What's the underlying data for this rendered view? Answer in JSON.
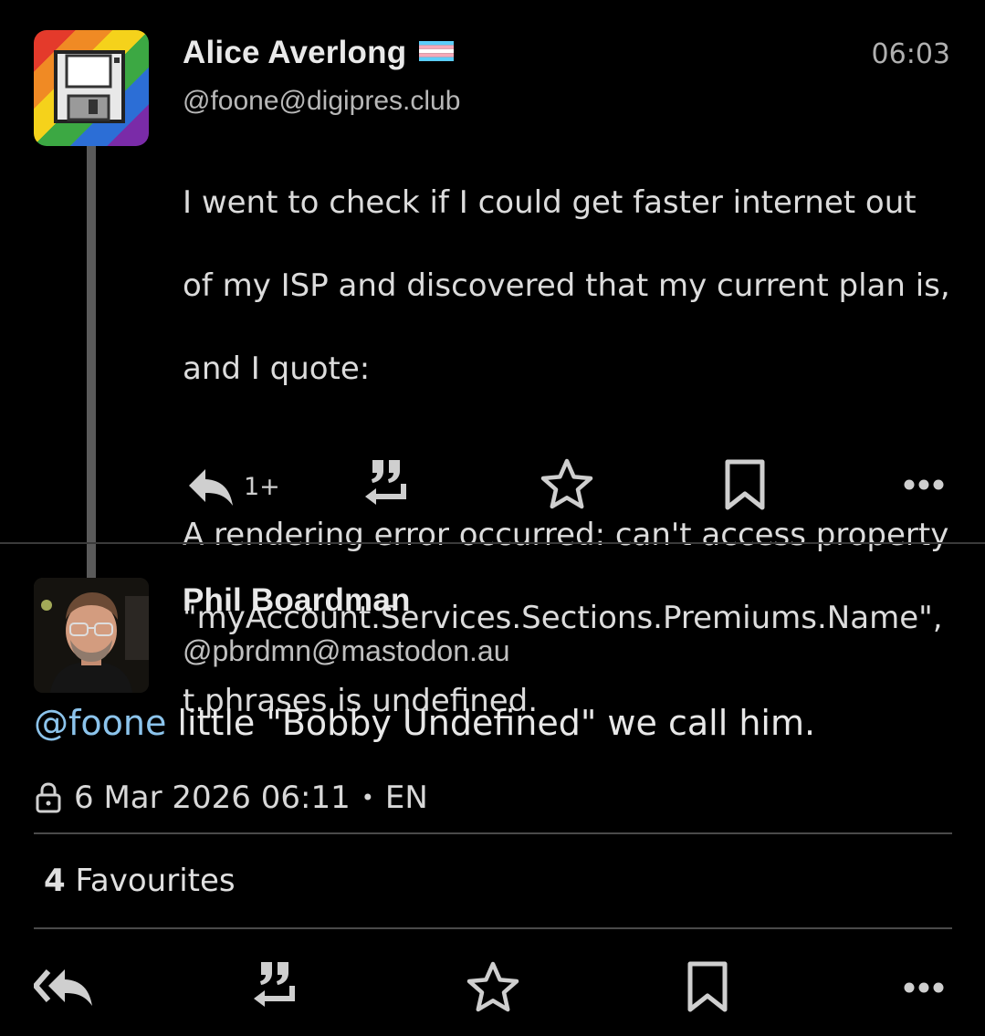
{
  "post": {
    "author_name": "Alice Averlong",
    "handle": "@foone@digipres.club",
    "time": "06:03",
    "body_lines": [
      "I went to check if I could get faster internet out",
      "of my ISP and discovered that my current plan is,",
      "and I quote:",
      "",
      "A rendering error occurred: can't access property",
      "\"myAccount.Services.Sections.Premiums.Name\",",
      "t.phrases is undefined."
    ],
    "reply_count": "1+",
    "icons": [
      "reply-icon",
      "boost-icon",
      "favourite-icon",
      "bookmark-icon",
      "more-icon"
    ]
  },
  "reply": {
    "author_name": "Phil Boardman",
    "handle": "@pbrdmn@mastodon.au",
    "mention": "@foone",
    "text": " little \"Bobby Undefined\" we call him.",
    "date": "6 Mar 2026 06:11",
    "separator": "•",
    "language": "EN",
    "favourites_count": "4",
    "favourites_label": "Favourites",
    "icons": [
      "reply-all-icon",
      "boost-icon",
      "favourite-icon",
      "bookmark-icon",
      "more-icon"
    ]
  },
  "colors": {
    "background": "#000000",
    "mention": "#8cc4ec",
    "thread_line": "#5a5a5a"
  }
}
